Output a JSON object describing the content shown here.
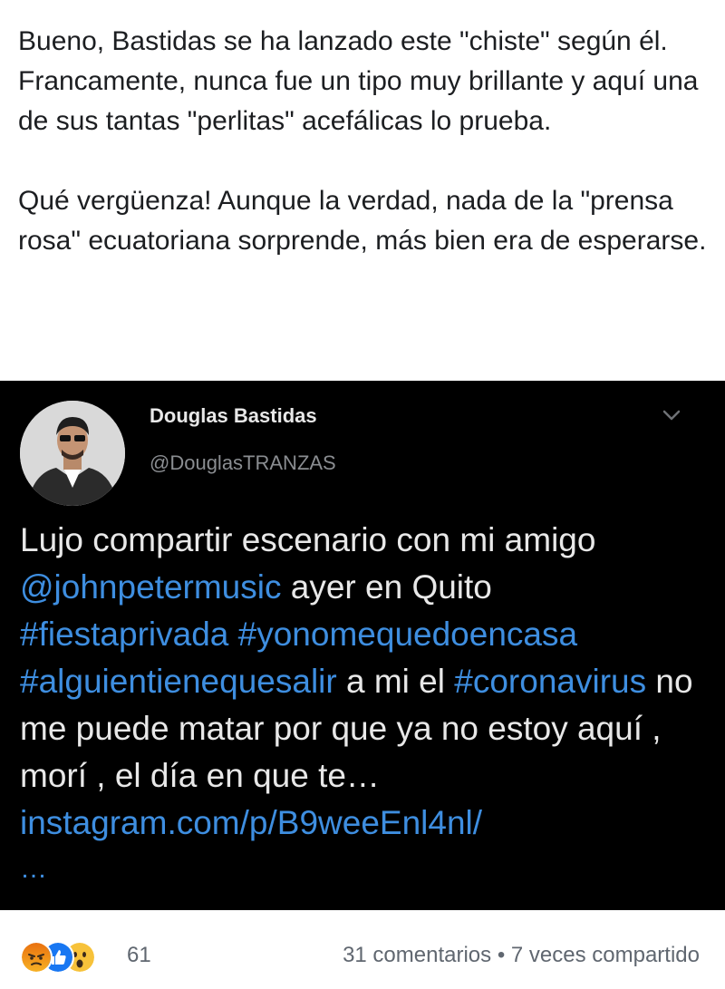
{
  "post": {
    "paragraph_1": "Bueno, Bastidas se ha lanzado este \"chiste\" según él. Francamente, nunca fue un tipo muy brillante y aquí una de sus tantas \"perlitas\" acefálicas lo prueba.",
    "paragraph_2": "Qué vergüenza! Aunque la verdad, nada de la \"prensa rosa\" ecuatoriana sorprende, más bien era de esperarse."
  },
  "tweet": {
    "author_name": "Douglas Bastidas",
    "author_handle": "@DouglasTRANZAS",
    "text_1": "Lujo compartir escenario con mi amigo ",
    "mention": "@johnpetermusic",
    "text_2": " ayer en Quito ",
    "hashtag_1": "#fiestaprivada",
    "space_1": " ",
    "hashtag_2": "#yonomequedoencasa",
    "space_2": " ",
    "hashtag_3": "#alguientienequesalir",
    "text_3": " a mi el ",
    "hashtag_4": "#coronavirus",
    "text_4": " no me puede matar por que ya no estoy aquí , morí , el día en que te… ",
    "link": "instagram.com/p/B9weeEnl4nl/",
    "more": "…"
  },
  "footer": {
    "reaction_icons": [
      "angry-icon",
      "like-icon",
      "wow-icon"
    ],
    "reaction_count": "61",
    "stats": "31 comentarios • 7 veces compartido"
  },
  "colors": {
    "link": "#3e8ee0",
    "tweet_bg": "#000000",
    "text_dark": "#1c1e21",
    "muted": "#606770"
  }
}
